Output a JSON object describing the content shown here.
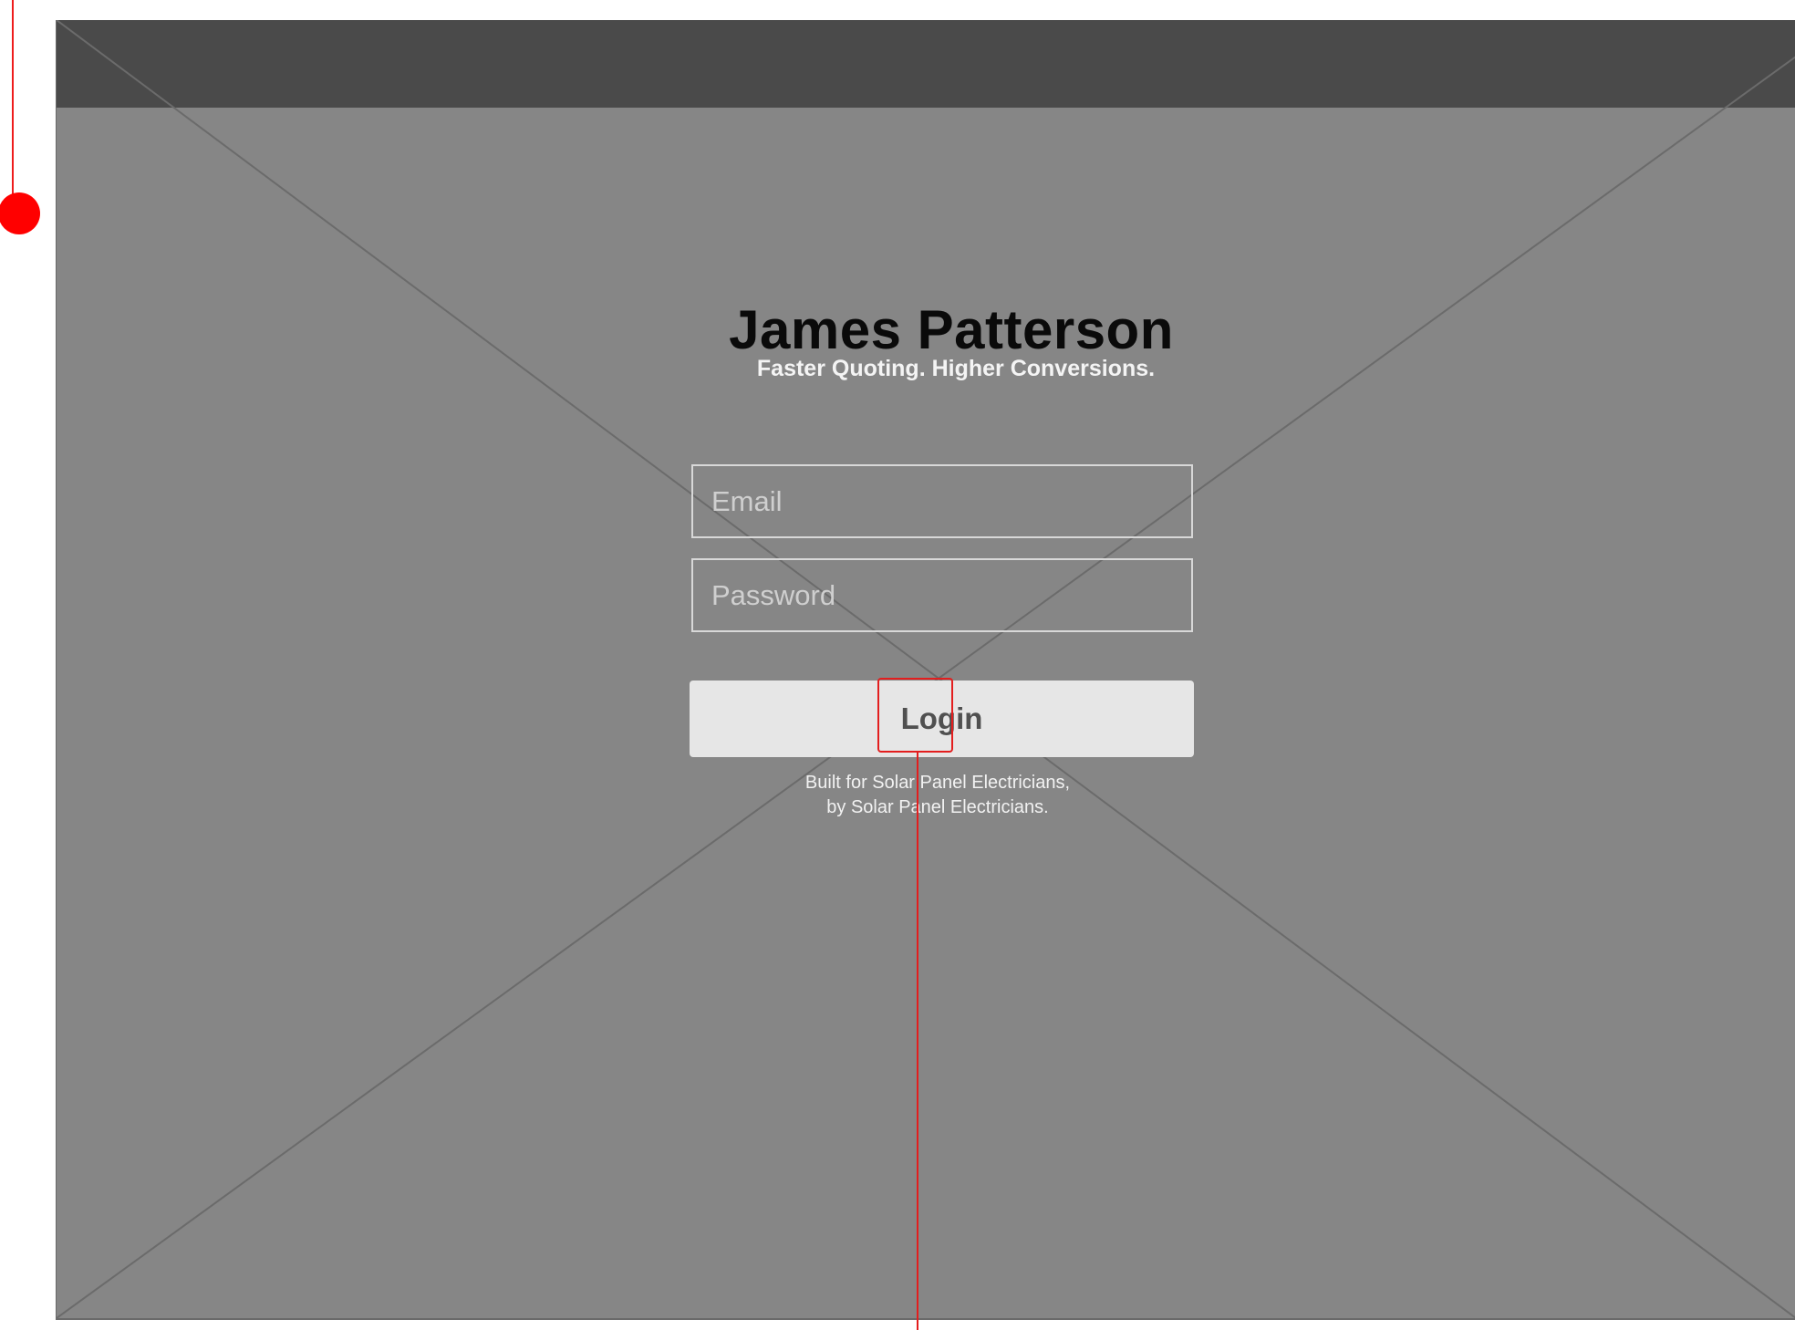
{
  "header": {
    "title": "James Patterson",
    "subtitle": "Faster Quoting. Higher Conversions."
  },
  "form": {
    "email_placeholder": "Email",
    "password_placeholder": "Password",
    "login_label": "Login"
  },
  "footer": {
    "tagline_line1": "Built for Solar Panel Electricians,",
    "tagline_line2": "by Solar Panel Electricians."
  },
  "colors": {
    "background": "#868686",
    "topbar": "#4a4a4a",
    "button": "#e6e6e6",
    "annotation": "#e31e1e"
  }
}
